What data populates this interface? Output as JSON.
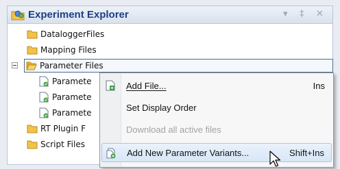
{
  "panel": {
    "title": "Experiment Explorer",
    "controls": {
      "dropdown": "▾",
      "pin": "‡",
      "close": "✕"
    }
  },
  "tree": {
    "items": [
      {
        "label": "DataloggerFiles",
        "icon": "folder-icon"
      },
      {
        "label": "Mapping Files",
        "icon": "folder-icon"
      },
      {
        "label": "Parameter Files",
        "icon": "open-folder-icon",
        "selected": true
      },
      {
        "label": "Paramete",
        "icon": "parameter-file-icon"
      },
      {
        "label": "Paramete",
        "icon": "parameter-file-icon"
      },
      {
        "label": "Paramete",
        "icon": "parameter-file-icon"
      },
      {
        "label": "RT Plugin F",
        "icon": "folder-icon"
      },
      {
        "label": "Script Files",
        "icon": "folder-icon"
      }
    ]
  },
  "context_menu": {
    "items": [
      {
        "label": "Add File...",
        "shortcut": "Ins",
        "icon": "add-file-icon",
        "enabled": true
      },
      {
        "label": "Set Display Order",
        "shortcut": "",
        "icon": "",
        "enabled": true
      },
      {
        "label": "Download all active files",
        "shortcut": "",
        "icon": "",
        "enabled": false
      },
      {
        "label": "Add New Parameter Variants...",
        "shortcut": "Shift+Ins",
        "icon": "add-variants-icon",
        "enabled": true,
        "hover": true
      }
    ]
  },
  "colors": {
    "title": "#1b3f86",
    "folder": "#f2c24a",
    "selection_border": "#4f6a8f",
    "hover": "#d7e6f7"
  }
}
